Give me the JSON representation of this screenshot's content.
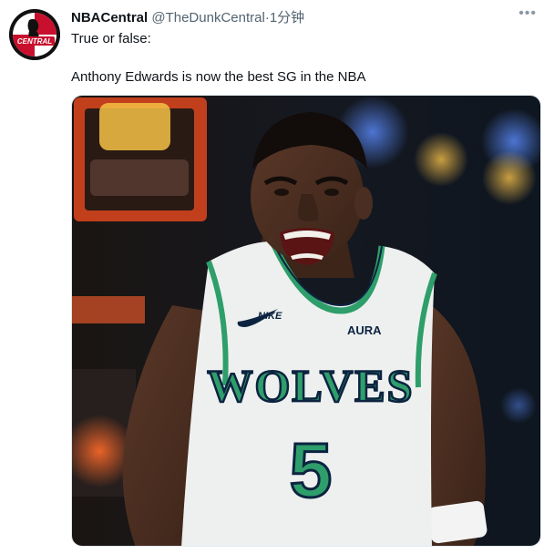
{
  "tweet": {
    "display_name": "NBACentral",
    "handle": "@TheDunkCentral",
    "separator": "·",
    "time": "1分钟",
    "more_icon": "more-horizontal-icon",
    "text_line1": "True or false:",
    "text_line2": "Anthony Edwards is now the best SG in the NBA"
  },
  "avatar": {
    "label": "CENTRAL",
    "colors": {
      "ring": "#111111",
      "red": "#c8102e",
      "white": "#ffffff"
    }
  },
  "photo": {
    "jersey_text": "WOLVES",
    "jersey_number": "5",
    "sponsor": "AURA",
    "brand": "NIKE",
    "colors": {
      "jersey": "#eef0ef",
      "trim": "#2e9e6a",
      "navy": "#0c2340",
      "skin": "#4a2e22"
    }
  }
}
